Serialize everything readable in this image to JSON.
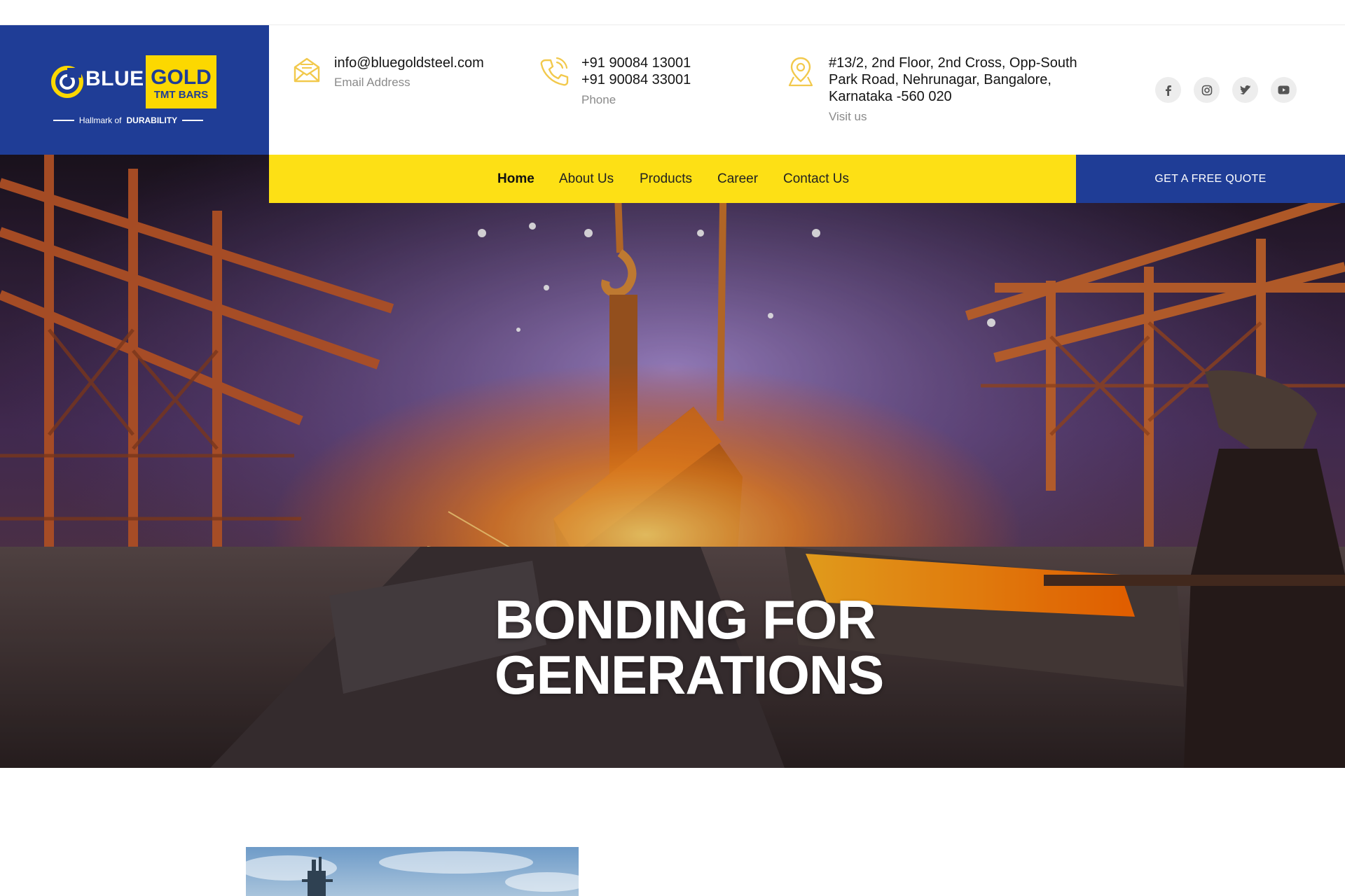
{
  "logo": {
    "word_blue": "BLUE",
    "word_gold": "GOLD",
    "sub": "TMT BARS",
    "tagline_prefix": "Hallmark of",
    "tagline_strong": "DURABILITY"
  },
  "contact": {
    "email": {
      "value": "info@bluegoldsteel.com",
      "label": "Email Address",
      "icon": "envelope-icon"
    },
    "phone": {
      "line1": "+91 90084 13001",
      "line2": "+91 90084 33001",
      "label": "Phone",
      "icon": "phone-icon"
    },
    "address": {
      "line1": "#13/2, 2nd Floor, 2nd Cross, Opp-South",
      "line2": "Park Road, Nehrunagar, Bangalore,",
      "line3": "Karnataka -560 020",
      "label": "Visit us",
      "icon": "map-pin-icon"
    }
  },
  "social": [
    "facebook-icon",
    "instagram-icon",
    "twitter-icon",
    "youtube-icon"
  ],
  "nav": {
    "items": [
      {
        "label": "Home",
        "active": true
      },
      {
        "label": "About Us",
        "active": false
      },
      {
        "label": "Products",
        "active": false
      },
      {
        "label": "Career",
        "active": false
      },
      {
        "label": "Contact Us",
        "active": false
      }
    ],
    "cta": "GET A FREE QUOTE"
  },
  "hero": {
    "line1": "BONDING FOR",
    "line2": "GENERATIONS"
  },
  "colors": {
    "brand_blue": "#1f3d96",
    "brand_yellow": "#fde015",
    "icon_yellow": "#f2c94c"
  }
}
